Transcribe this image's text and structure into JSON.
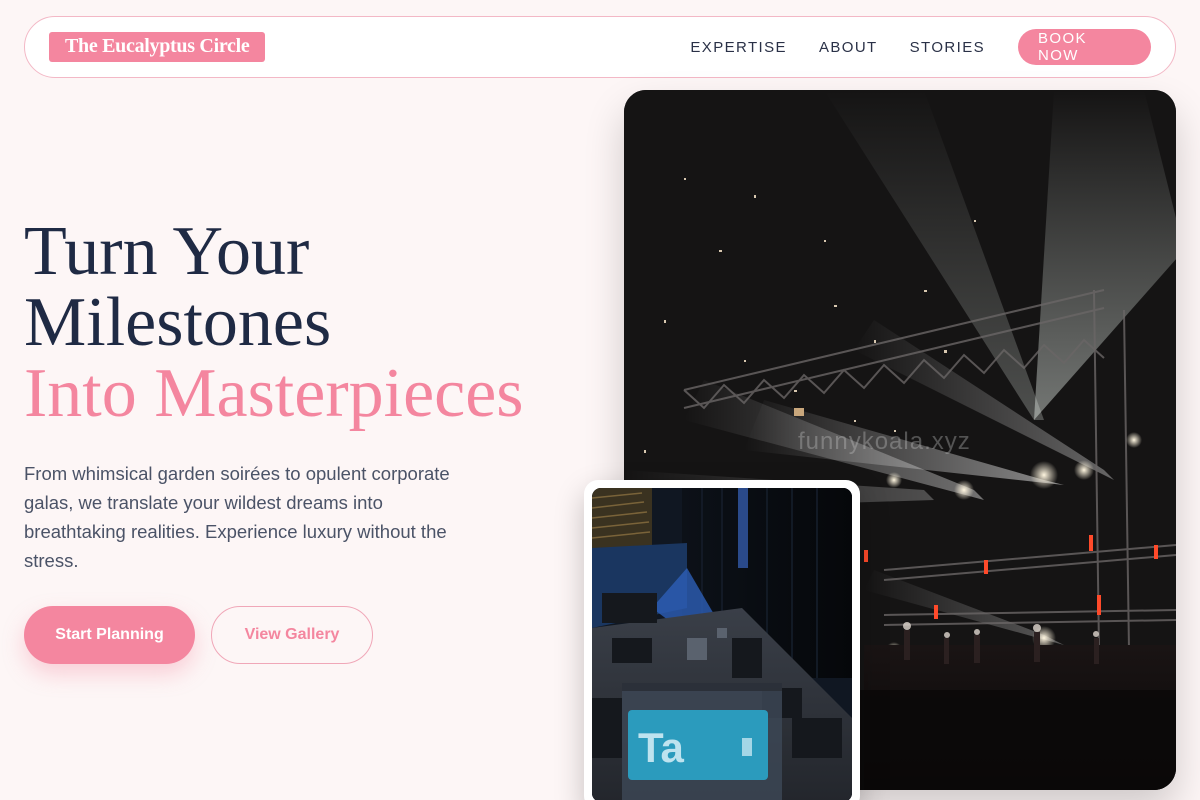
{
  "brand": {
    "name": "The Eucalyptus Circle"
  },
  "nav": {
    "links": [
      "EXPERTISE",
      "ABOUT",
      "STORIES"
    ],
    "cta": "BOOK NOW"
  },
  "hero": {
    "headline_line1": "Turn Your",
    "headline_line2": "Milestones",
    "headline_accent": "Into Masterpieces",
    "subtext": "From whimsical garden soirées to opulent corporate galas, we translate your wildest dreams into breathtaking realities. Experience luxury without the stress.",
    "primary_button": "Start Planning",
    "secondary_button": "View Gallery"
  },
  "images": {
    "watermark": "funnykoala.xyz"
  },
  "colors": {
    "accent": "#f4869f",
    "heading": "#1f2a44",
    "background": "#fdf6f6"
  }
}
